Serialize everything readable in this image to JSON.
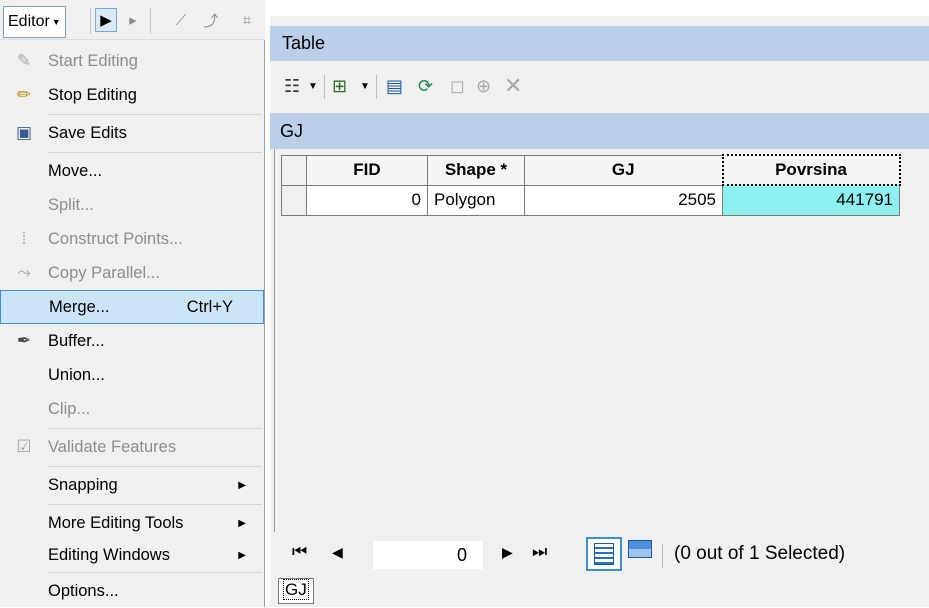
{
  "editor_toolbar": {
    "menu_label": "Editor",
    "icons": [
      "pointer-icon",
      "edit-annotation-icon",
      "straight-segment-icon",
      "trace-icon",
      "edit-vertices-icon"
    ]
  },
  "editor_menu": {
    "items": [
      {
        "label": "Start Editing",
        "enabled": false,
        "icon": "pencil-icon"
      },
      {
        "label": "Stop Editing",
        "enabled": true,
        "icon": "stop-editing-icon"
      },
      {
        "label": "Save Edits",
        "enabled": true,
        "icon": "save-edits-icon"
      },
      {
        "label": "Move...",
        "enabled": true
      },
      {
        "label": "Split...",
        "enabled": false
      },
      {
        "label": "Construct Points...",
        "enabled": false,
        "icon": "construct-points-icon"
      },
      {
        "label": "Copy Parallel...",
        "enabled": false,
        "icon": "copy-parallel-icon"
      },
      {
        "label": "Merge...",
        "enabled": true,
        "shortcut": "Ctrl+Y",
        "highlighted": true
      },
      {
        "label": "Buffer...",
        "enabled": true,
        "icon": "buffer-icon"
      },
      {
        "label": "Union...",
        "enabled": true
      },
      {
        "label": "Clip...",
        "enabled": false
      },
      {
        "label": "Validate Features",
        "enabled": false,
        "icon": "validate-icon"
      },
      {
        "label": "Snapping",
        "enabled": true,
        "submenu": true
      },
      {
        "label": "More Editing Tools",
        "enabled": true,
        "submenu": true
      },
      {
        "label": "Editing Windows",
        "enabled": true,
        "submenu": true
      },
      {
        "label": "Options...",
        "enabled": true
      }
    ]
  },
  "table_window": {
    "title": "Table",
    "layer_name": "GJ",
    "columns": [
      "FID",
      "Shape *",
      "GJ",
      "Povrsina"
    ],
    "rows": [
      {
        "FID": "0",
        "Shape": "Polygon",
        "GJ": "2505",
        "Povrsina": "441791"
      }
    ],
    "navigation": {
      "current_record": "0",
      "status": "(0 out of 1 Selected)"
    },
    "tab_label": "GJ"
  },
  "colors": {
    "title_bar": "#bccfe8",
    "menu_highlight": "#cce4f7",
    "selected_cell": "#8ef1f1"
  }
}
